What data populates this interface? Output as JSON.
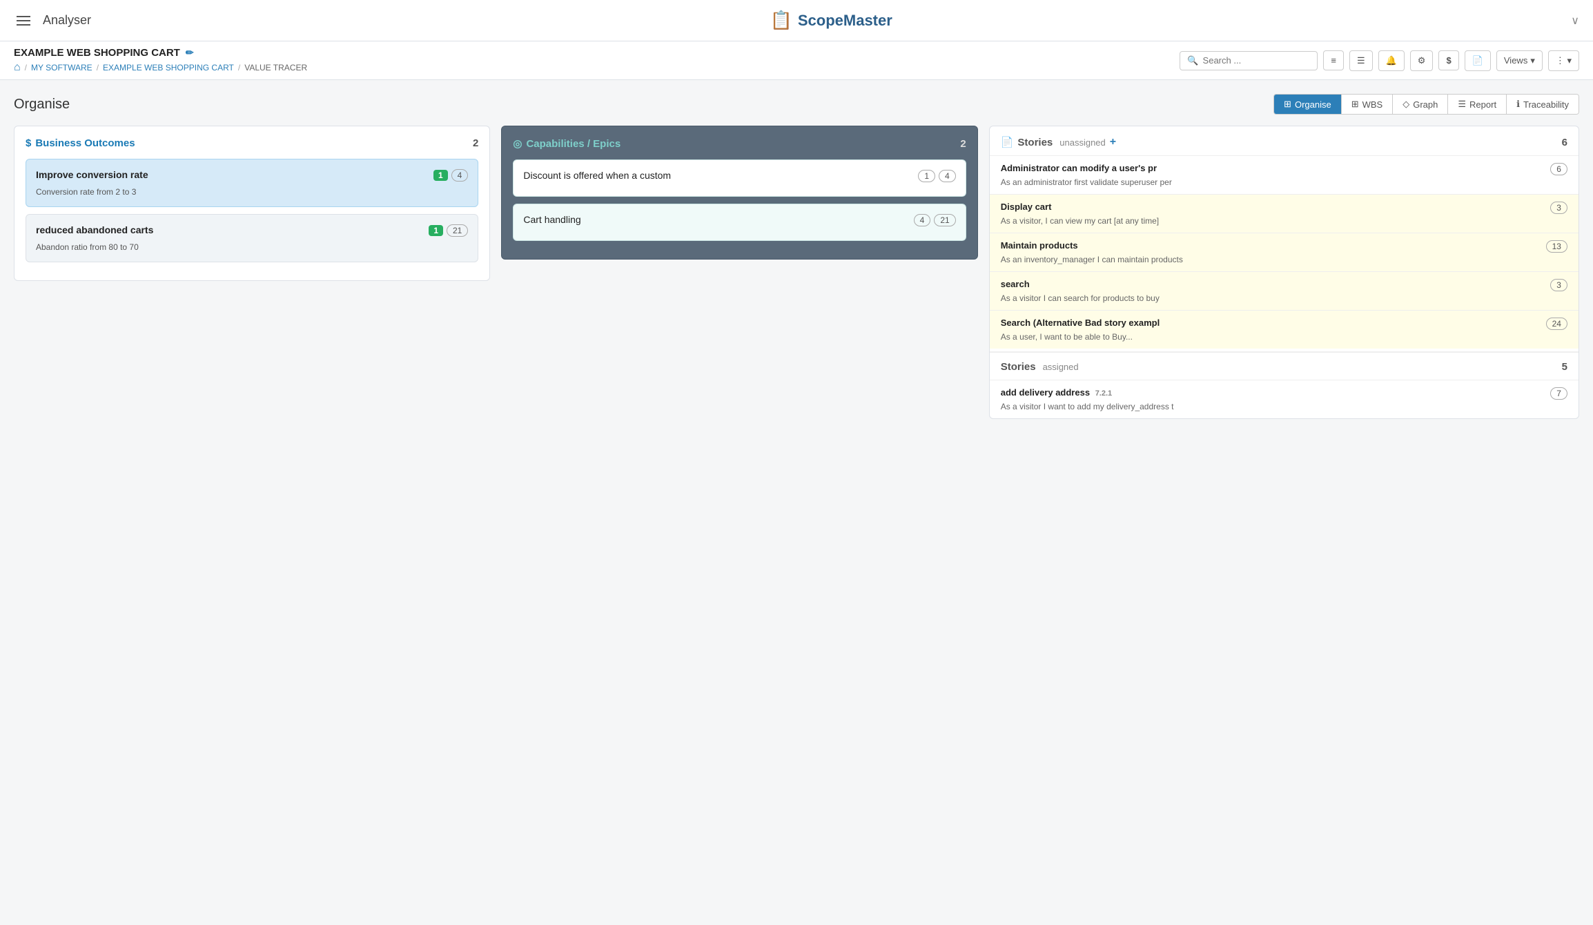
{
  "header": {
    "hamburger_label": "Menu",
    "app_title": "Analyser",
    "logo_text": "ScopeMaster",
    "logo_icon": "📋",
    "chevron": "∨"
  },
  "sub_header": {
    "project_title": "EXAMPLE WEB SHOPPING CART",
    "edit_icon": "✏",
    "home_icon": "⌂",
    "breadcrumbs": [
      {
        "label": "MY SOFTWARE",
        "link": true
      },
      {
        "label": "EXAMPLE WEB SHOPPING CART",
        "link": true
      },
      {
        "label": "VALUE TRACER",
        "link": false
      }
    ],
    "search_placeholder": "Search ..."
  },
  "toolbar": {
    "buttons": [
      {
        "id": "list",
        "icon": "≡",
        "label": "list"
      },
      {
        "id": "doc",
        "icon": "☰",
        "label": "doc"
      },
      {
        "id": "bell",
        "icon": "🔔",
        "label": "notifications"
      },
      {
        "id": "gear",
        "icon": "⚙",
        "label": "settings"
      },
      {
        "id": "dollar",
        "icon": "$",
        "label": "value"
      },
      {
        "id": "doc2",
        "icon": "📄",
        "label": "document"
      }
    ],
    "views_label": "Views",
    "more_icon": "⋮"
  },
  "page": {
    "heading": "Organise",
    "view_tabs": [
      {
        "id": "organise",
        "label": "Organise",
        "icon": "⊞",
        "active": true
      },
      {
        "id": "wbs",
        "label": "WBS",
        "icon": "⊞",
        "active": false
      },
      {
        "id": "graph",
        "label": "Graph",
        "icon": "◇",
        "active": false
      },
      {
        "id": "report",
        "label": "Report",
        "icon": "☰",
        "active": false
      },
      {
        "id": "traceability",
        "label": "Traceability",
        "icon": "ℹ",
        "active": false
      }
    ]
  },
  "business_outcomes": {
    "title": "Business Outcomes",
    "icon": "$",
    "count": 2,
    "items": [
      {
        "id": "bo1",
        "title": "Improve conversion rate",
        "subtitle": "Conversion rate from 2 to 3",
        "badge_green": "1",
        "badge_outline": "4",
        "selected": true
      },
      {
        "id": "bo2",
        "title": "reduced abandoned carts",
        "subtitle": "Abandon ratio from 80 to 70",
        "badge_green": "1",
        "badge_outline": "21",
        "selected": false
      }
    ]
  },
  "capabilities": {
    "title": "Capabilities / Epics",
    "icon": "◎",
    "count": 2,
    "items": [
      {
        "id": "cap1",
        "title": "Discount is offered when a custom",
        "badge_outline": "1",
        "badge_count": "4"
      },
      {
        "id": "cap2",
        "title": "Cart handling",
        "badge_outline": "4",
        "badge_count": "21"
      }
    ]
  },
  "stories_unassigned": {
    "title": "Stories",
    "status": "unassigned",
    "add_icon": "+",
    "count": 6,
    "items": [
      {
        "id": "s1",
        "title": "Administrator can modify a user's pr",
        "subtitle": "As an administrator first validate superuser per",
        "badge": "6",
        "highlight": false
      },
      {
        "id": "s2",
        "title": "Display cart",
        "subtitle": "As a visitor, I can view my cart [at any time]",
        "badge": "3",
        "highlight": true
      },
      {
        "id": "s3",
        "title": "Maintain products",
        "subtitle": "As an inventory_manager I can maintain products",
        "badge": "13",
        "highlight": true
      },
      {
        "id": "s4",
        "title": "search",
        "subtitle": "As a visitor I can search for products to buy",
        "badge": "3",
        "highlight": true
      },
      {
        "id": "s5",
        "title": "Search (Alternative Bad story exampl",
        "subtitle": "As a user, I want to be able to Buy...",
        "badge": "24",
        "highlight": true
      }
    ]
  },
  "stories_assigned": {
    "title": "Stories",
    "status": "assigned",
    "count": 5,
    "items": [
      {
        "id": "sa1",
        "title": "add delivery address",
        "version": "7.2.1",
        "subtitle": "As a visitor I want to add my delivery_address t",
        "badge": "7",
        "highlight": false
      }
    ]
  }
}
